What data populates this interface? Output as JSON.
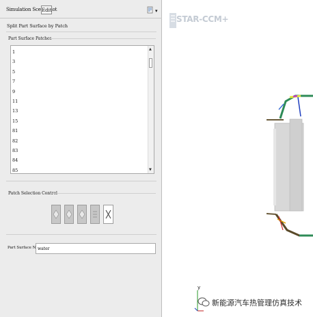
{
  "toolbar": {
    "title": "Simulation Scene/Plot",
    "edit_button": "Edit"
  },
  "panel": {
    "title": "Split Part Surface by Patch"
  },
  "patches": {
    "header": "Part Surface Patches",
    "items": [
      "1",
      "3",
      "5",
      "7",
      "9",
      "11",
      "13",
      "15",
      "81",
      "82",
      "83",
      "84",
      "85"
    ]
  },
  "selection": {
    "header": "Patch Selection Control"
  },
  "name_field": {
    "label": "Part Surface Name",
    "value": "water"
  },
  "viewport": {
    "logo": "STAR-CCM+",
    "axis_label": "y"
  },
  "watermark": {
    "text": "新能源汽车热管理仿真技术"
  }
}
